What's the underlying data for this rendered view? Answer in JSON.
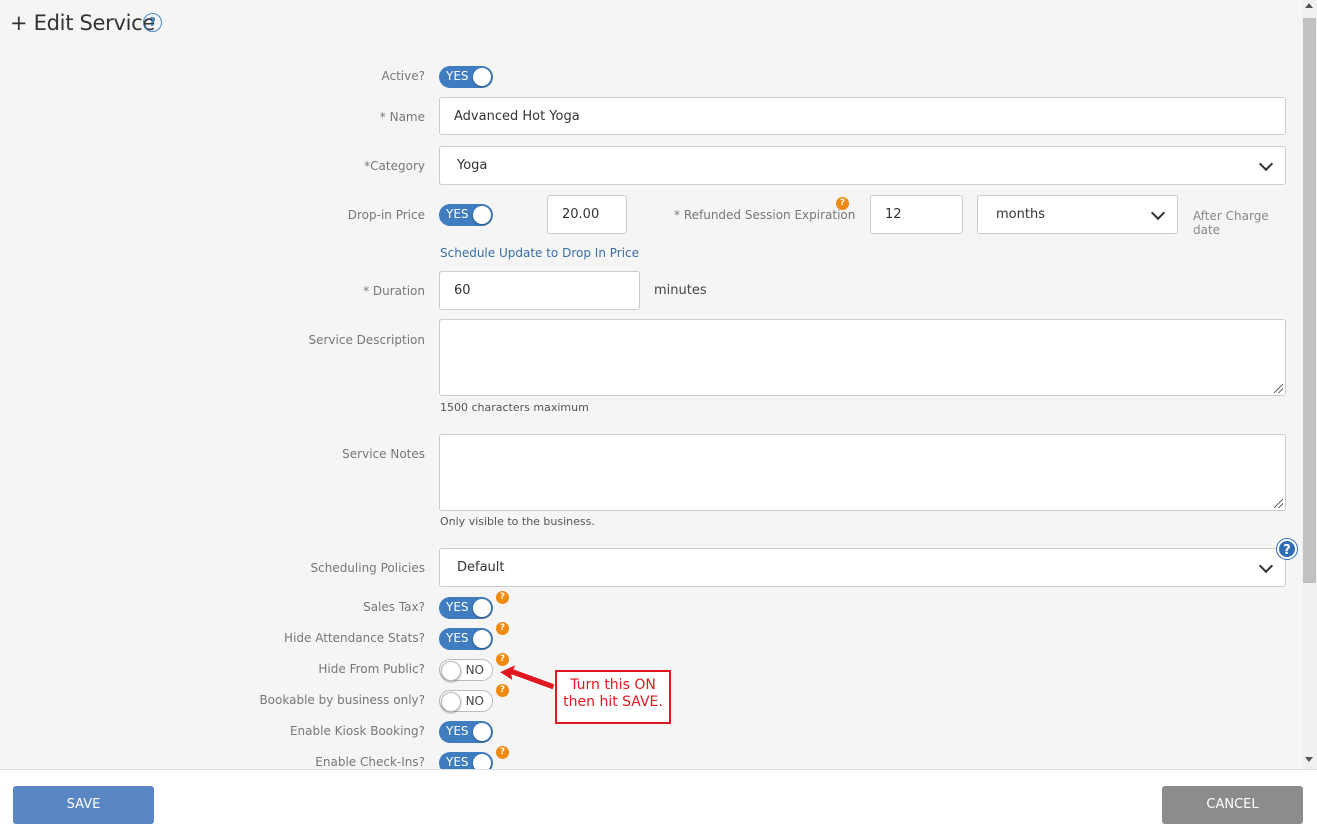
{
  "header": {
    "title": "+ Edit Service",
    "help_glyph": "?"
  },
  "form": {
    "active": {
      "label": "Active?",
      "state": "YES"
    },
    "name": {
      "label": "* Name",
      "value": "Advanced Hot Yoga"
    },
    "category": {
      "label": "*Category",
      "value": "Yoga"
    },
    "drop_in": {
      "label": "Drop-in Price",
      "state": "YES",
      "price": "20.00",
      "refund_label": "* Refunded Session Expiration",
      "refund_value": "12",
      "refund_unit": "months",
      "after_label": "After Charge date",
      "schedule_link": "Schedule Update to Drop In Price"
    },
    "duration": {
      "label": "* Duration",
      "value": "60",
      "unit": "minutes"
    },
    "description": {
      "label": "Service Description",
      "value": "",
      "hint": "1500 characters maximum"
    },
    "notes": {
      "label": "Service Notes",
      "value": "",
      "hint": "Only visible to the business."
    },
    "scheduling": {
      "label": "Scheduling Policies",
      "value": "Default"
    },
    "sales_tax": {
      "label": "Sales Tax?",
      "state": "YES"
    },
    "hide_stats": {
      "label": "Hide Attendance Stats?",
      "state": "YES"
    },
    "hide_public": {
      "label": "Hide From Public?",
      "state": "NO"
    },
    "bookable": {
      "label": "Bookable by business only?",
      "state": "NO"
    },
    "kiosk": {
      "label": "Enable Kiosk Booking?",
      "state": "YES"
    },
    "checkins": {
      "label": "Enable Check-Ins?",
      "state": "YES"
    }
  },
  "annotation": {
    "line1": "Turn this ON",
    "line2": "then hit SAVE.",
    "color": "#e0171e"
  },
  "footer": {
    "save": "SAVE",
    "cancel": "CANCEL",
    "save_color": "#5b86c4",
    "cancel_color": "#8c8c8c"
  },
  "badges": {
    "question": "?"
  }
}
